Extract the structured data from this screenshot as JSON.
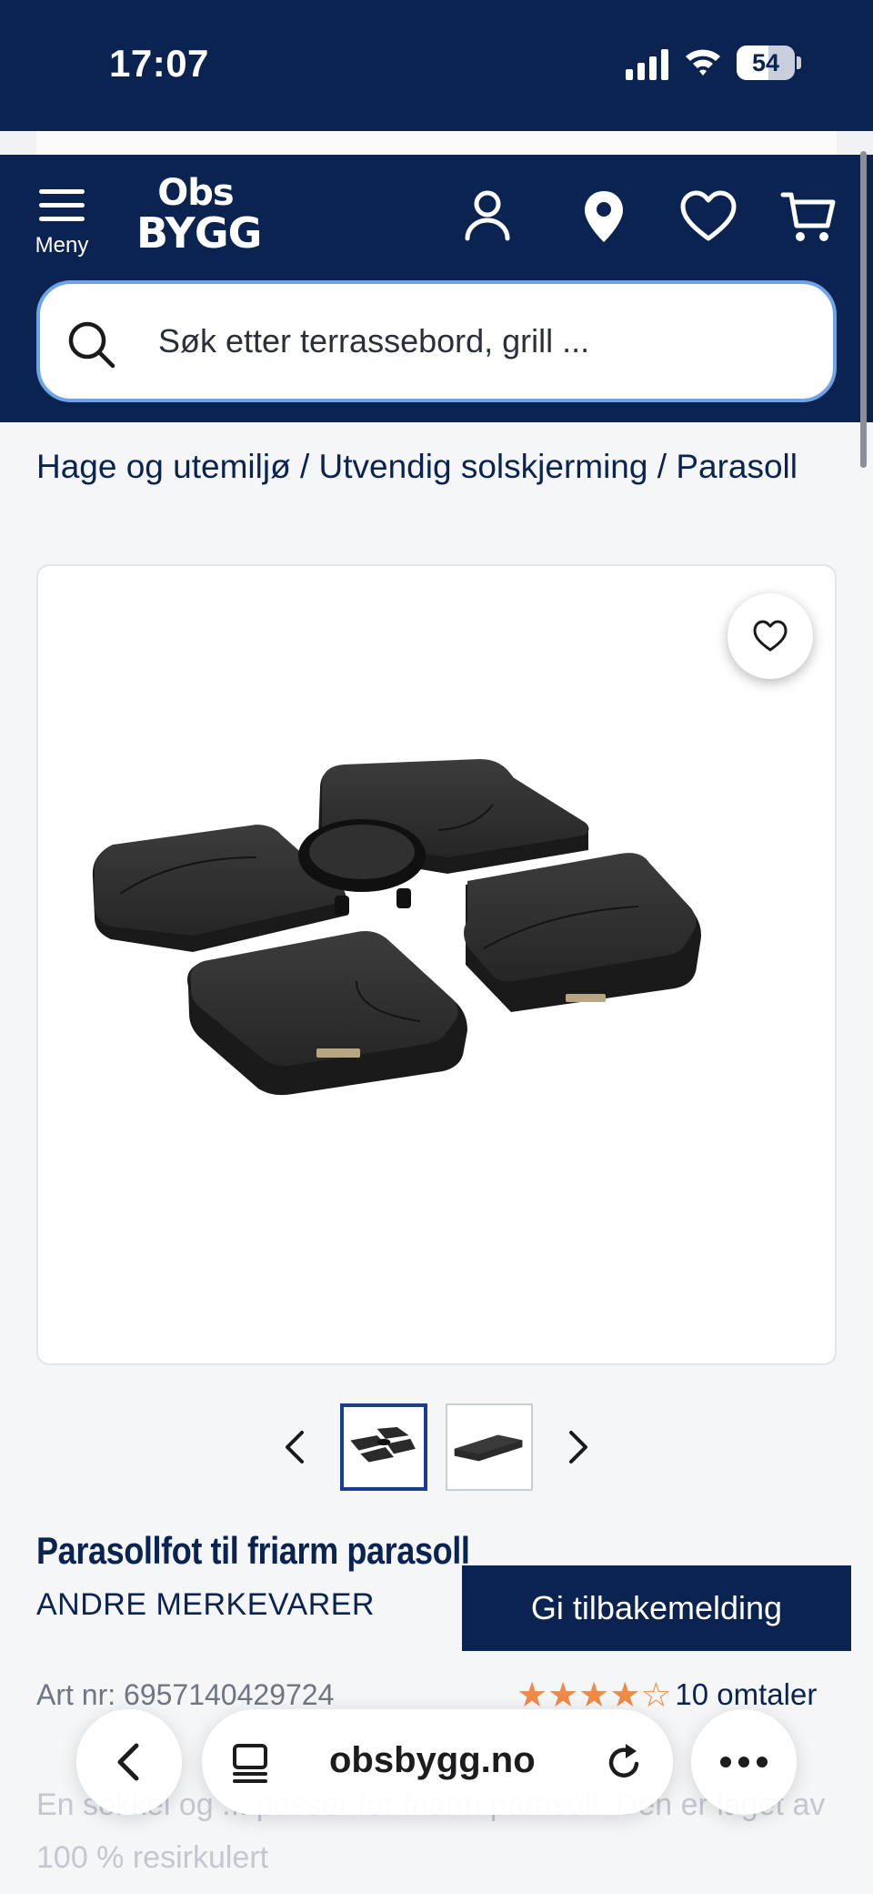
{
  "status_bar": {
    "time": "17:07",
    "battery_percent": "54",
    "battery_level": 0.54,
    "icons": [
      "signal-icon",
      "wifi-icon",
      "battery-icon"
    ]
  },
  "header": {
    "menu_label": "Meny",
    "logo_top": "Obs",
    "logo_bottom": "BYGG",
    "icons": [
      "menu-icon",
      "user-icon",
      "location-icon",
      "heart-icon",
      "cart-icon"
    ],
    "brand_color": "#0b2350"
  },
  "search": {
    "placeholder": "Søk etter terrassebord, grill ..."
  },
  "breadcrumb": {
    "items": [
      "Hage og utemiljø",
      "Utvendig solskjerming",
      "Parasoll"
    ],
    "separator": " / "
  },
  "gallery": {
    "favorite_icon": "heart-icon",
    "image_alt": "Parasollfot til friarm parasoll",
    "thumbnail_count": 2,
    "selected_index": 0
  },
  "product": {
    "title": "Parasollfot til friarm parasoll",
    "brand": "ANDRE MERKEVARER",
    "art_nr": "Art nr: 6957140429724",
    "rating": 4,
    "rating_max": 5,
    "reviews": "10 omtaler",
    "star_color": "#f08a47",
    "description": "En sokkel og ... passer for friarm parasoll. Den er laget av 100 % resirkulert"
  },
  "feedback": {
    "label": "Gi tilbakemelding"
  },
  "browser": {
    "url": "obsbygg.no",
    "icons": [
      "back-icon",
      "tab-icon",
      "reload-icon",
      "more-icon"
    ]
  }
}
